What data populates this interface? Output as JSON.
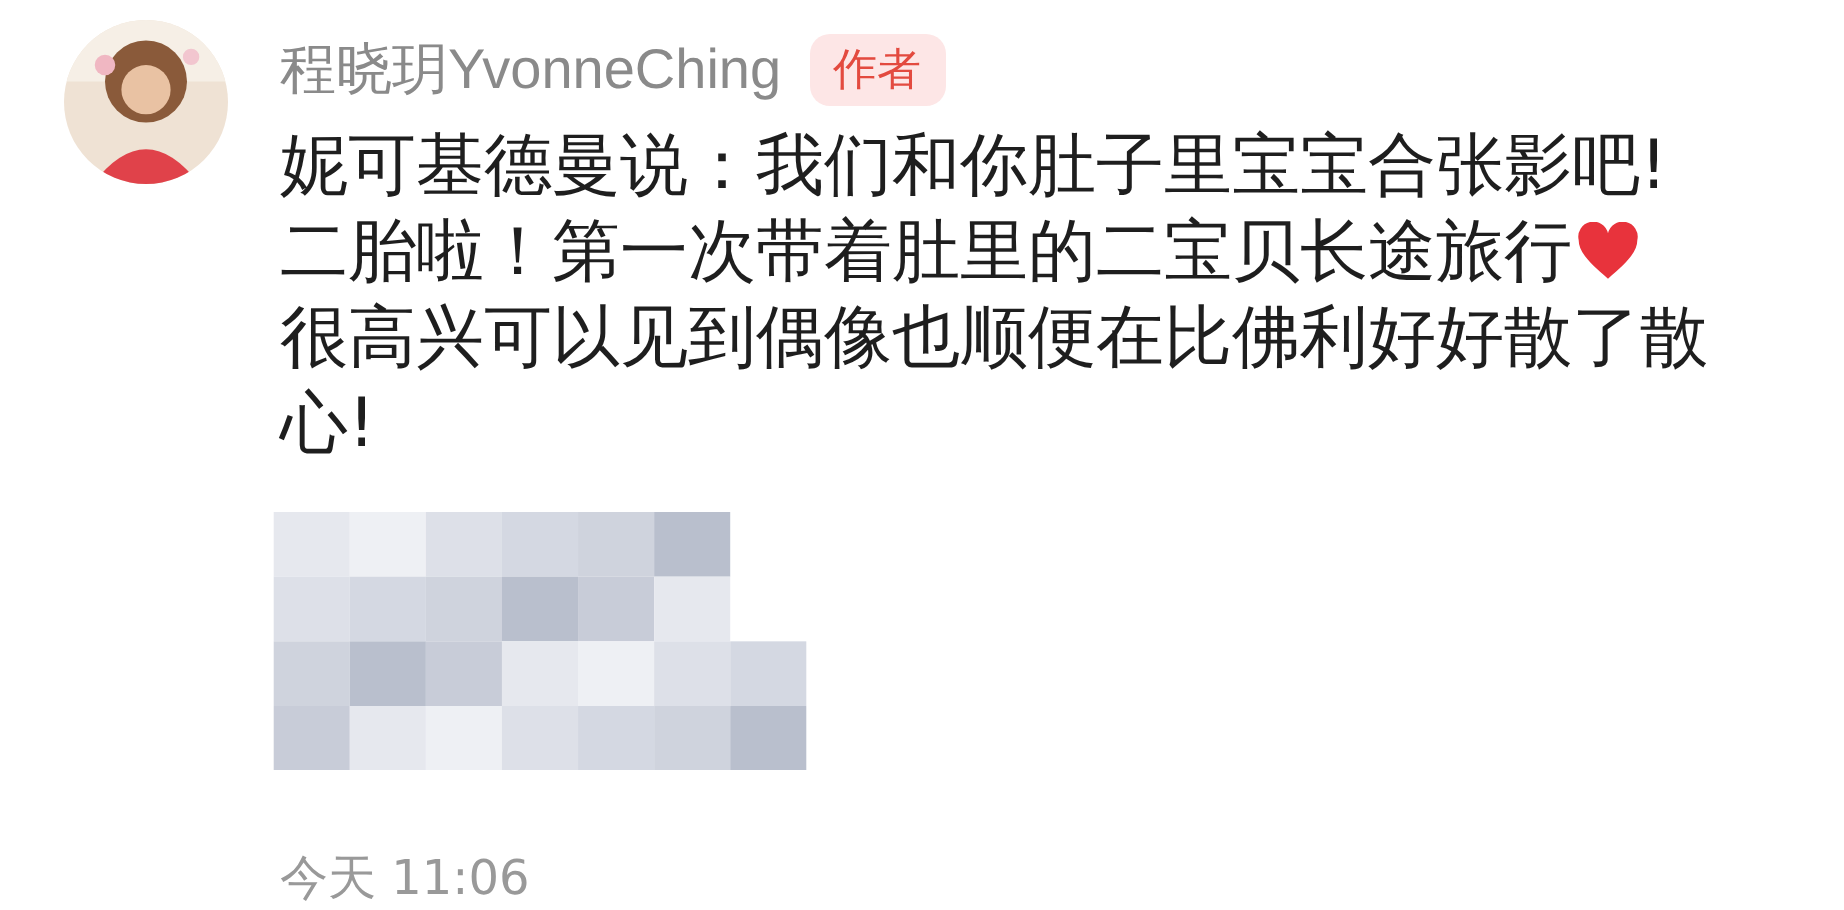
{
  "comment": {
    "author": "程晓玥YvonneChing",
    "badge": "作者",
    "lines": [
      {
        "text": "妮可基德曼说：我们和你肚子里宝宝合张影吧!",
        "heart": false
      },
      {
        "text": "二胎啦！第一次带着肚里的二宝贝长途旅行",
        "heart": true
      },
      {
        "text": "很高兴可以见到偶像也顺便在比佛利好好散了散",
        "heart": false
      },
      {
        "text": "心!",
        "heart": false
      }
    ],
    "time": "今天 11:06"
  }
}
